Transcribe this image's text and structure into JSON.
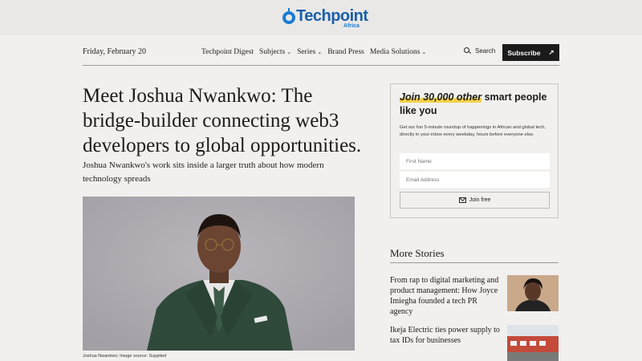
{
  "brand": {
    "logo_text": "Techpoint",
    "logo_sub": "Africa"
  },
  "nav": {
    "date": "Friday, February 20",
    "items": [
      {
        "label": "Techpoint Digest",
        "dropdown": false
      },
      {
        "label": "Subjects",
        "dropdown": true
      },
      {
        "label": "Series",
        "dropdown": true
      },
      {
        "label": "Brand Press",
        "dropdown": false
      },
      {
        "label": "Media Solutions",
        "dropdown": true
      }
    ],
    "search_label": "Search",
    "subscribe_label": "Subscribe"
  },
  "article": {
    "headline": "Meet Joshua Nwankwo: The bridge-builder connecting web3 developers to global opportunities.",
    "dek": "Joshua Nwankwo's work sits inside a larger truth about how modern technology spreads",
    "image_caption": "Joshua Nwankwo; Image source: Supplied"
  },
  "newsletter": {
    "title_highlight": "Join 30,000 other",
    "title_rest": " smart people like you",
    "description": "Get our fun 5-minute roundup of happenings in African and global tech, directly in your inbox every weekday, hours before everyone else.",
    "first_name_placeholder": "First Name",
    "email_placeholder": "Email Address",
    "join_label": "Join free"
  },
  "more_stories": {
    "title": "More Stories",
    "items": [
      {
        "title": "From rap to digital marketing and product management: How Joyce Imiegha founded a tech PR agency"
      },
      {
        "title": "Ikeja Electric ties power supply to tax IDs for businesses"
      }
    ]
  },
  "colors": {
    "accent_blue": "#1a5fa8",
    "highlight": "#f4d24a",
    "suit_green": "#2f4a3a",
    "button_dark": "#1b1b1b"
  }
}
